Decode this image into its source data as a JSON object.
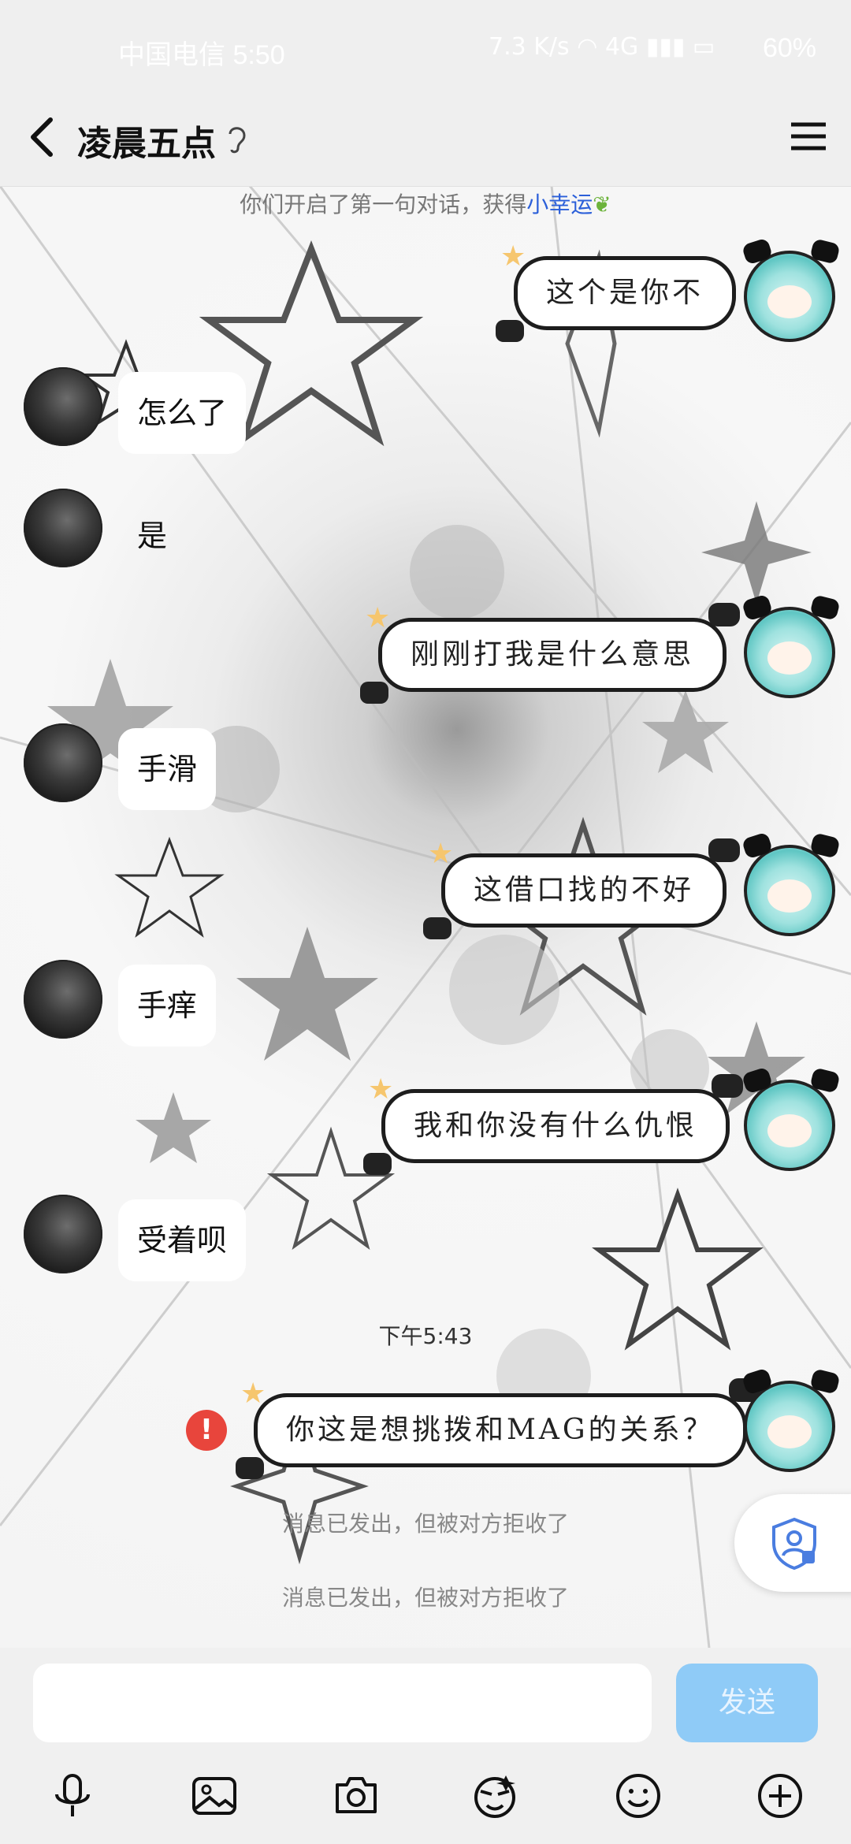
{
  "status_bar": {
    "carrier": "中国电信 5:50",
    "net_speed": "7.3 K/s",
    "signal": "4G",
    "battery": "60%"
  },
  "header": {
    "title": "凌晨五点"
  },
  "system": {
    "first_chat_prefix": "你们开启了第一句对话，获得",
    "first_chat_link": "小幸运"
  },
  "messages": [
    {
      "side": "right",
      "text": "这个是你不"
    },
    {
      "side": "left",
      "text": "怎么了"
    },
    {
      "side": "left",
      "text": "是"
    },
    {
      "side": "right",
      "text": "刚刚打我是什么意思"
    },
    {
      "side": "left",
      "text": "手滑"
    },
    {
      "side": "right",
      "text": "这借口找的不好"
    },
    {
      "side": "left",
      "text": "手痒"
    },
    {
      "side": "right",
      "text": "我和你没有什么仇恨"
    },
    {
      "side": "left",
      "text": "受着呗"
    },
    {
      "side": "right",
      "text": "你这是想挑拨和MAG的关系？"
    }
  ],
  "time_divider": "下午5:43",
  "error_badge": "!",
  "rejected_notices": [
    "消息已发出，但被对方拒收了",
    "消息已发出，但被对方拒收了"
  ],
  "input": {
    "value": "",
    "send_label": "发送"
  },
  "toolbar_icons": [
    "microphone-icon",
    "image-icon",
    "camera-icon",
    "sticker-icon",
    "emoji-icon",
    "plus-icon"
  ],
  "colors": {
    "link": "#2b5fd9",
    "send_button": "#8fcbf7",
    "error": "#e8453c"
  }
}
